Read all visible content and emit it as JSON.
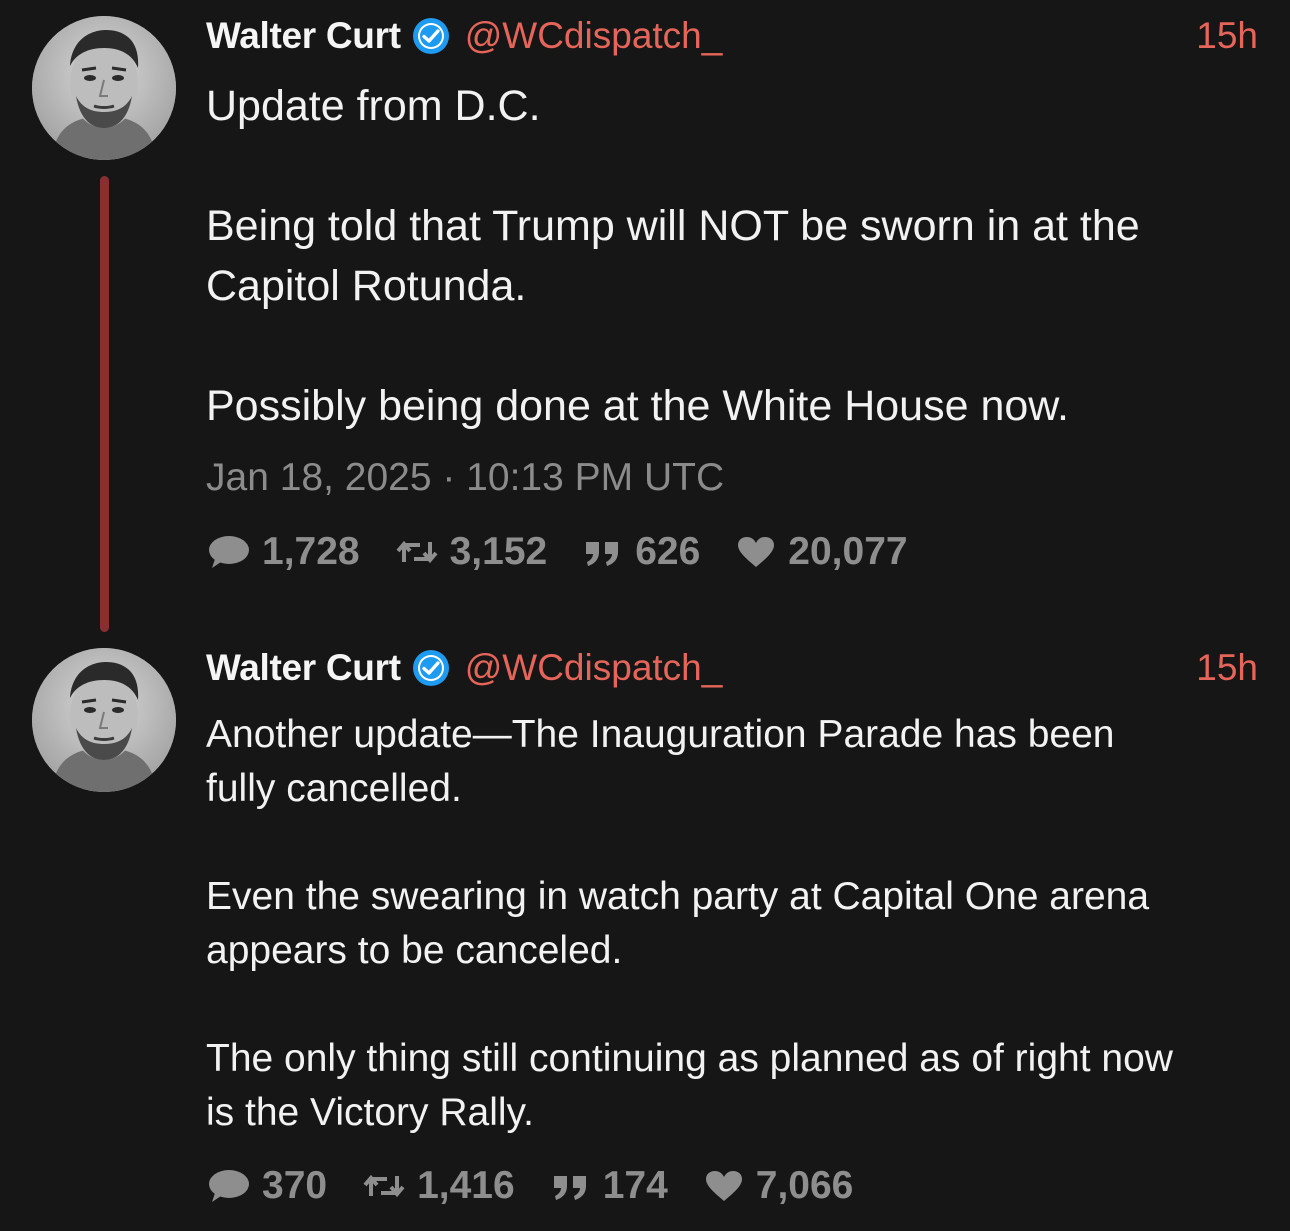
{
  "colors": {
    "background": "#161616",
    "accent": "#e5655a",
    "thread_line": "#8a2f2f",
    "verified": "#1d9bf0",
    "muted": "#8b8b8b"
  },
  "icons": {
    "verified": "verified-badge-icon",
    "reply": "speech-bubble-icon",
    "retweet": "retweet-arrows-icon",
    "quote": "quote-marks-icon",
    "like": "heart-icon"
  },
  "tweets": [
    {
      "author": {
        "name": "Walter Curt",
        "handle": "@WCdispatch_"
      },
      "time": "15h",
      "paragraphs": [
        [
          "Update from D.C."
        ],
        [
          "Being told that Trump will NOT be sworn in at the",
          "Capitol Rotunda."
        ],
        [
          "Possibly being done at the White House now."
        ]
      ],
      "date": "Jan 18, 2025 · 10:13 PM UTC",
      "stats": {
        "replies": "1,728",
        "retweets": "3,152",
        "quotes": "626",
        "likes": "20,077"
      }
    },
    {
      "author": {
        "name": "Walter Curt",
        "handle": "@WCdispatch_"
      },
      "time": "15h",
      "paragraphs": [
        [
          "Another update—The Inauguration Parade has been",
          "fully cancelled."
        ],
        [
          "Even the swearing in watch party at Capital One arena",
          "appears to be canceled."
        ],
        [
          "The only thing still continuing as planned as of right now",
          "is the Victory Rally."
        ]
      ],
      "stats": {
        "replies": "370",
        "retweets": "1,416",
        "quotes": "174",
        "likes": "7,066"
      }
    }
  ]
}
